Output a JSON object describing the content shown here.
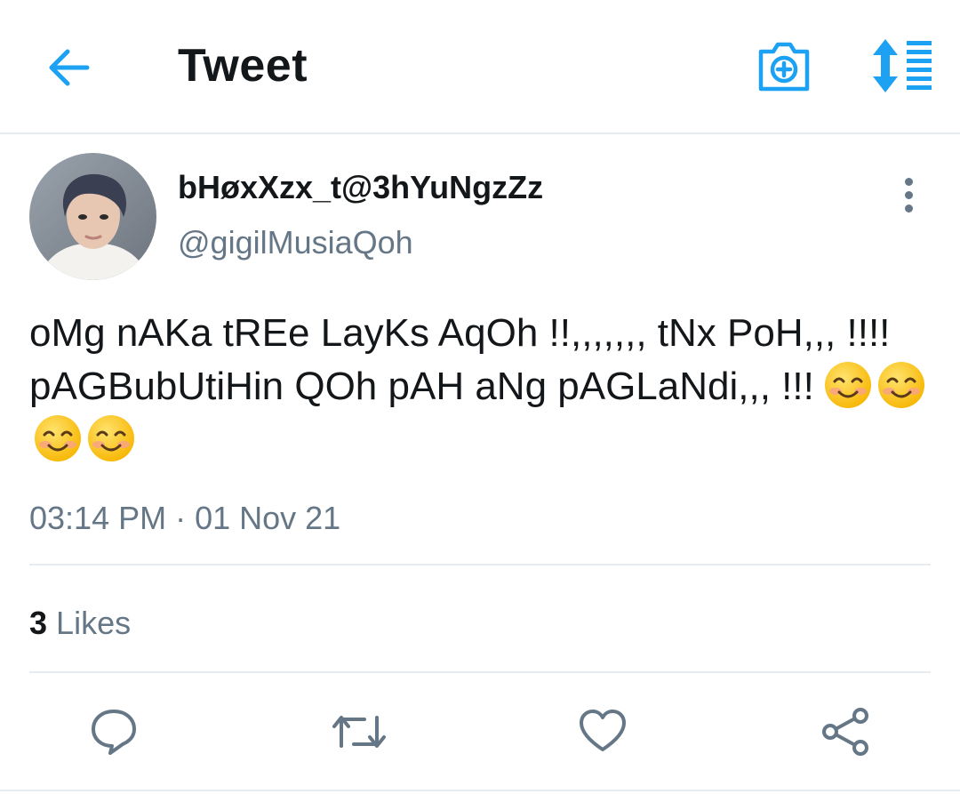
{
  "header": {
    "title": "Tweet",
    "back_icon": "arrow-left-icon",
    "camera_icon": "camera-add-icon",
    "sort_icon": "sort-list-icon",
    "accent_color": "#1da1f2"
  },
  "tweet": {
    "display_name": "bHøxXzx_t@3hYuNgzZz",
    "handle": "@gigilMusiaQoh",
    "text": "oMg nAKa tREe LayKs AqOh !!,,,,,,, tNx PoH,,, !!!! pAGBubUtiHin QOh pAH aNg pAGLaNdi,,, !!!",
    "emojis": [
      "smiling-face-icon",
      "smiling-face-icon",
      "smiling-face-icon",
      "smiling-face-icon"
    ],
    "timestamp": "03:14 PM · 01 Nov 21",
    "likes_count": "3",
    "likes_label": "Likes"
  },
  "actions": {
    "reply_icon": "reply-icon",
    "retweet_icon": "retweet-icon",
    "like_icon": "heart-icon",
    "share_icon": "share-icon",
    "icon_color": "#657786"
  }
}
